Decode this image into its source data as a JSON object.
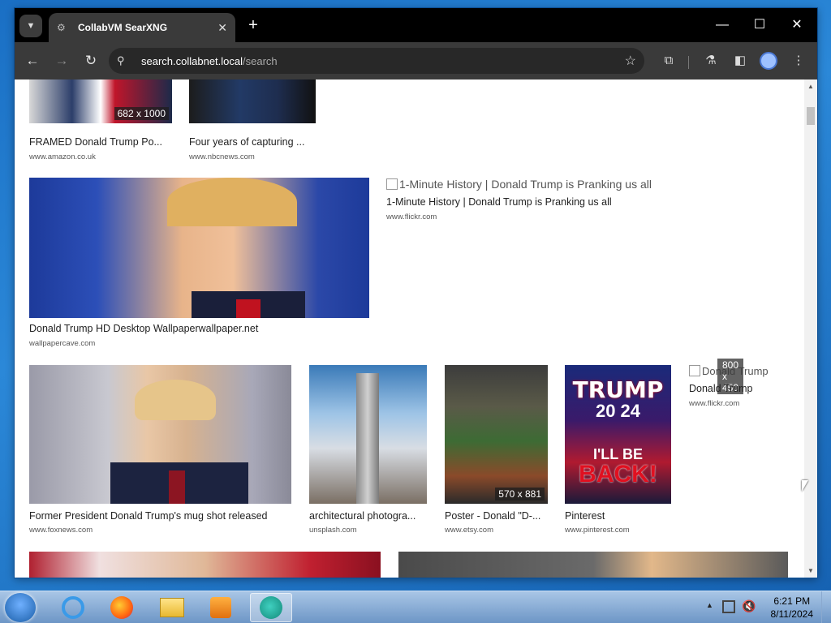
{
  "browser": {
    "tab_title": "CollabVM SearXNG",
    "tab_close": "✕",
    "new_tab": "+",
    "url_host": "search.collabnet.local",
    "url_path": "/search",
    "window_controls": {
      "minimize": "—",
      "maximize": "☐",
      "close": "✕"
    }
  },
  "results": [
    {
      "title": "FRAMED Donald Trump Po...",
      "source": "www.amazon.co.uk",
      "dimensions": "682 x 1000"
    },
    {
      "title": "Four years of capturing ...",
      "source": "www.nbcnews.com"
    },
    {
      "title": "Donald Trump HD Desktop Wallpaperwallpaper.net",
      "source": "wallpapercave.com"
    },
    {
      "title": "1-Minute History | Donald Trump is Pranking us all",
      "alt": "1-Minute History | Donald Trump is Pranking us all",
      "source": "www.flickr.com"
    },
    {
      "title": "Former President Donald Trump's mug shot released",
      "source": "www.foxnews.com"
    },
    {
      "title": "architectural photogra...",
      "source": "unsplash.com"
    },
    {
      "title": "Poster - Donald \"D-...",
      "source": "www.etsy.com",
      "dimensions": "570 x 881"
    },
    {
      "title": "Pinterest",
      "source": "www.pinterest.com",
      "poster_line1": "TRUMP",
      "poster_line2": "20  24",
      "poster_line3": "I'LL BE",
      "poster_line4": "BACK!"
    },
    {
      "title": "Donald Trump",
      "alt": "Donald Trump",
      "source": "www.flickr.com",
      "dimensions": "800 x 450"
    }
  ],
  "taskbar": {
    "time": "6:21 PM",
    "date": "8/11/2024"
  },
  "colors": {
    "accent": "#1a6fc4",
    "tab_bg": "#3a3a3a",
    "titlebar": "#000000"
  }
}
